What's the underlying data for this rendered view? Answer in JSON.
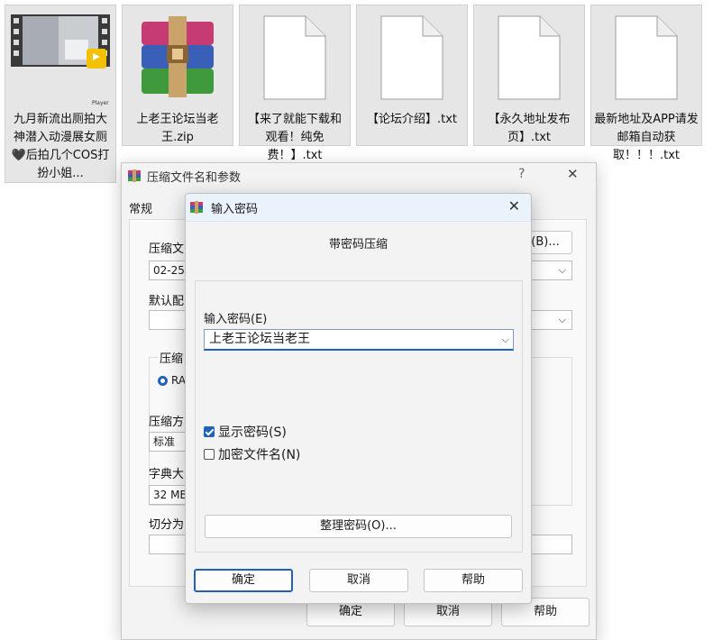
{
  "files": [
    {
      "name": "九月新流出厕拍大神潜入动漫展女厕🖤后拍几个COS打扮小姐...",
      "icon": "video-thumbnail-icon",
      "badge": "Player"
    },
    {
      "name": "上老王论坛当老王.zip",
      "icon": "winrar-archive-icon"
    },
    {
      "name": "【来了就能下载和观看！纯免费！】.txt",
      "icon": "text-file-icon"
    },
    {
      "name": "【论坛介绍】.txt",
      "icon": "text-file-icon"
    },
    {
      "name": "【永久地址发布页】.txt",
      "icon": "text-file-icon"
    },
    {
      "name": "最新地址及APP请发邮箱自动获取！！！.txt",
      "icon": "text-file-icon"
    }
  ],
  "archive_dialog": {
    "title": "压缩文件名和参数",
    "help_symbol": "?",
    "close_symbol": "✕",
    "tab_general": "常规",
    "label_archive_name": "压缩文",
    "archive_name_value": "02-25-",
    "browse_label": "(B)...",
    "label_default": "默认配",
    "label_format": "压缩",
    "format_value": "RA",
    "label_method": "压缩方",
    "method_value": "标准",
    "label_dict": "字典大",
    "dict_value": "32 MB",
    "label_split": "切分为",
    "ok": "确定",
    "cancel": "取消",
    "help": "帮助"
  },
  "password_dialog": {
    "title": "输入密码",
    "close_symbol": "✕",
    "heading": "带密码压缩",
    "label_password": "输入密码(E)",
    "password_value": "上老王论坛当老王",
    "show_password": "显示密码(S)",
    "show_password_checked": true,
    "encrypt_names": "加密文件名(N)",
    "encrypt_names_checked": false,
    "organize": "整理密码(O)...",
    "ok": "确定",
    "cancel": "取消",
    "help": "帮助"
  },
  "colors": {
    "accent": "#1f62b6",
    "title_bar": "#eaf2fb"
  }
}
